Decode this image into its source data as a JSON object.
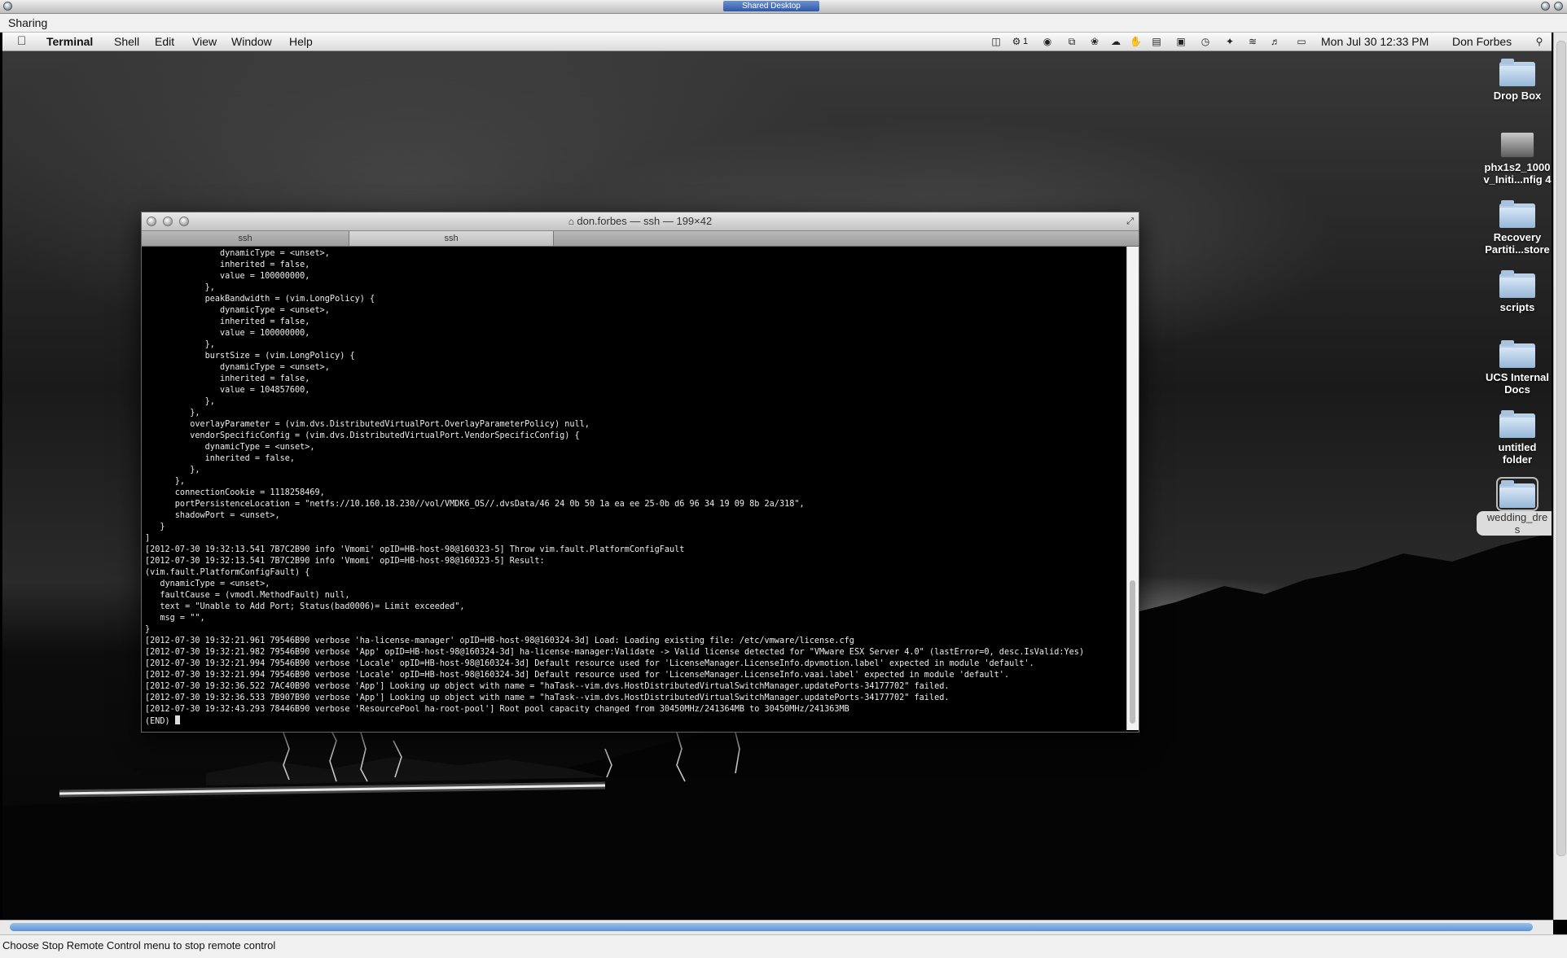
{
  "viewer": {
    "window_title": "Shared Desktop",
    "menu_label": "Sharing",
    "status_message": "Choose Stop Remote Control menu to stop remote control"
  },
  "mac_menubar": {
    "apple_icon": "apple-icon",
    "app_name": "Terminal",
    "menus": [
      "Shell",
      "Edit",
      "View",
      "Window",
      "Help"
    ],
    "status_icons": [
      "dropbox-icon",
      "gear-badge-icon",
      "circle-icon",
      "screen-icon",
      "paw-icon",
      "cloud-icon",
      "hand-icon",
      "battery-strip-icon",
      "monitor-icon",
      "time-machine-icon",
      "bluetooth-icon",
      "wifi-icon",
      "volume-icon",
      "battery-icon"
    ],
    "badge_count": "1",
    "datetime": "Mon Jul 30  12:33 PM",
    "user": "Don Forbes",
    "search_icon": "spotlight-search-icon"
  },
  "desktop_items": [
    {
      "label": "Drop Box",
      "icon": "folder-icon"
    },
    {
      "label": "phx1s2_1000\nv_Initi...nfig 4",
      "icon": "disk-image-icon"
    },
    {
      "label": "Recovery\nPartiti...store",
      "icon": "folder-icon"
    },
    {
      "label": "scripts",
      "icon": "folder-icon"
    },
    {
      "label": "UCS Internal\nDocs",
      "icon": "folder-icon"
    },
    {
      "label": "untitled\nfolder",
      "icon": "folder-icon"
    },
    {
      "label": "wedding_dre\ns",
      "icon": "folder-icon"
    }
  ],
  "terminal": {
    "title": "don.forbes — ssh — 199×42",
    "tabs": [
      "ssh",
      "ssh"
    ],
    "lines": [
      "               dynamicType = <unset>,",
      "               inherited = false,",
      "               value = 100000000,",
      "            },",
      "            peakBandwidth = (vim.LongPolicy) {",
      "               dynamicType = <unset>,",
      "               inherited = false,",
      "               value = 100000000,",
      "            },",
      "            burstSize = (vim.LongPolicy) {",
      "               dynamicType = <unset>,",
      "               inherited = false,",
      "               value = 104857600,",
      "            },",
      "         },",
      "         overlayParameter = (vim.dvs.DistributedVirtualPort.OverlayParameterPolicy) null,",
      "         vendorSpecificConfig = (vim.dvs.DistributedVirtualPort.VendorSpecificConfig) {",
      "            dynamicType = <unset>,",
      "            inherited = false,",
      "         },",
      "      },",
      "      connectionCookie = 1118258469,",
      "      portPersistenceLocation = \"netfs://10.160.18.230//vol/VMDK6_OS//.dvsData/46 24 0b 50 1a ea ee 25-0b d6 96 34 19 09 8b 2a/318\",",
      "      shadowPort = <unset>,",
      "   }",
      "]",
      "[2012-07-30 19:32:13.541 7B7C2B90 info 'Vmomi' opID=HB-host-98@160323-5] Throw vim.fault.PlatformConfigFault",
      "[2012-07-30 19:32:13.541 7B7C2B90 info 'Vmomi' opID=HB-host-98@160323-5] Result:",
      "(vim.fault.PlatformConfigFault) {",
      "   dynamicType = <unset>,",
      "   faultCause = (vmodl.MethodFault) null,",
      "   text = \"Unable to Add Port; Status(bad0006)= Limit exceeded\",",
      "   msg = \"\",",
      "}",
      "[2012-07-30 19:32:21.961 79546B90 verbose 'ha-license-manager' opID=HB-host-98@160324-3d] Load: Loading existing file: /etc/vmware/license.cfg",
      "[2012-07-30 19:32:21.982 79546B90 verbose 'App' opID=HB-host-98@160324-3d] ha-license-manager:Validate -> Valid license detected for \"VMware ESX Server 4.0\" (lastError=0, desc.IsValid:Yes)",
      "[2012-07-30 19:32:21.994 79546B90 verbose 'Locale' opID=HB-host-98@160324-3d] Default resource used for 'LicenseManager.LicenseInfo.dpvmotion.label' expected in module 'default'.",
      "[2012-07-30 19:32:21.994 79546B90 verbose 'Locale' opID=HB-host-98@160324-3d] Default resource used for 'LicenseManager.LicenseInfo.vaai.label' expected in module 'default'.",
      "[2012-07-30 19:32:36.522 7AC40B90 verbose 'App'] Looking up object with name = \"haTask--vim.dvs.HostDistributedVirtualSwitchManager.updatePorts-34177702\" failed.",
      "[2012-07-30 19:32:36.533 7B907B90 verbose 'App'] Looking up object with name = \"haTask--vim.dvs.HostDistributedVirtualSwitchManager.updatePorts-34177702\" failed.",
      "[2012-07-30 19:32:43.293 78446B90 verbose 'ResourcePool ha-root-pool'] Root pool capacity changed from 30450MHz/241364MB to 30450MHz/241363MB"
    ],
    "prompt": "(END) "
  }
}
